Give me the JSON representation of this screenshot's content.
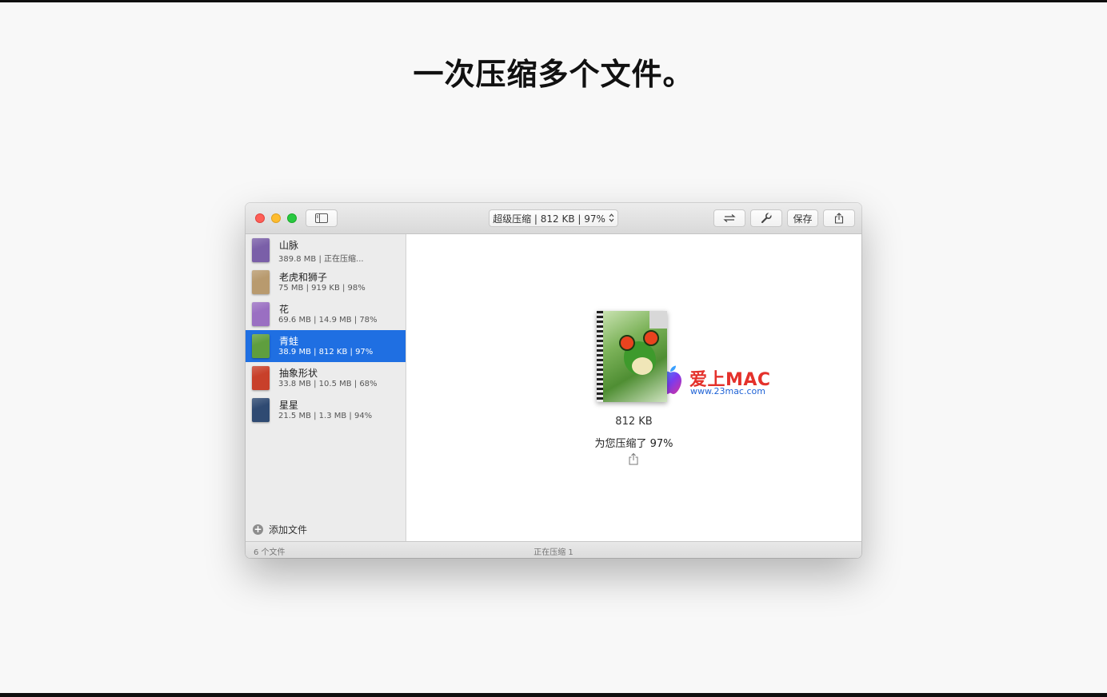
{
  "headline": "一次压缩多个文件。",
  "toolbar": {
    "mode_label": "超级压缩 | 812 KB | 97%",
    "save_label": "保存"
  },
  "files": [
    {
      "name": "山脉",
      "meta": "389.8 MB | 正在压缩...",
      "thumb_color": "#7a5fa8"
    },
    {
      "name": "老虎和狮子",
      "meta": "75 MB | 919 KB | 98%",
      "thumb_color": "#b89a6e"
    },
    {
      "name": "花",
      "meta": "69.6 MB | 14.9 MB | 78%",
      "thumb_color": "#9a6fc2"
    },
    {
      "name": "青蛙",
      "meta": "38.9 MB | 812 KB | 97%",
      "thumb_color": "#5f9e3e"
    },
    {
      "name": "抽象形状",
      "meta": "33.8 MB | 10.5 MB | 68%",
      "thumb_color": "#c8402a"
    },
    {
      "name": "星星",
      "meta": "21.5 MB | 1.3 MB | 94%",
      "thumb_color": "#2f4a72"
    }
  ],
  "selected_index": 3,
  "add_file_label": "添加文件",
  "preview": {
    "size": "812 KB",
    "saved": "为您压缩了 97%"
  },
  "status": {
    "file_count": "6 个文件",
    "compressing": "正在压缩 1"
  },
  "watermark": {
    "title": "爱上MAC",
    "url": "www.23mac.com"
  },
  "colors": {
    "selection": "#1f6fe2",
    "close": "#fe5f57",
    "minimize": "#febc2e",
    "zoom": "#28c840"
  }
}
